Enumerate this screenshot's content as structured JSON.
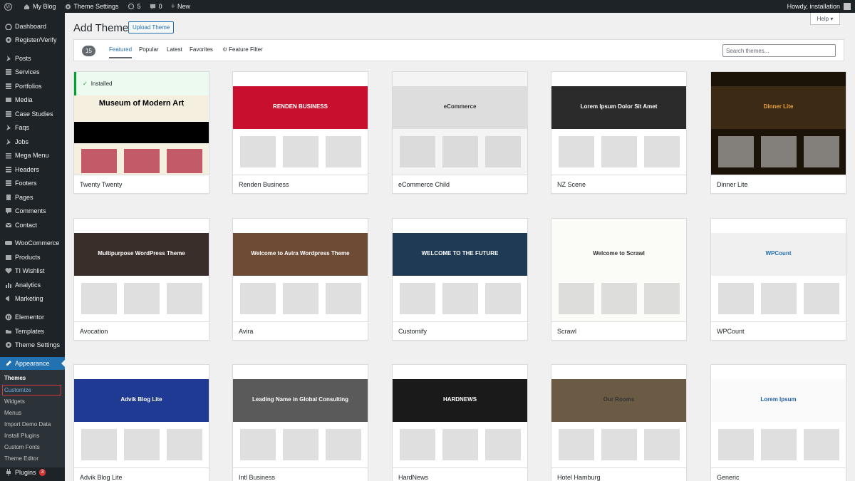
{
  "adminbar": {
    "site": "My Blog",
    "theme_settings": "Theme Settings",
    "updates": "5",
    "comments": "0",
    "new": "New",
    "howdy": "Howdy, installation"
  },
  "sidebar": {
    "items": [
      {
        "label": "Dashboard",
        "icon": "dashboard-icon"
      },
      {
        "label": "Register/Verify",
        "icon": "gear-icon"
      },
      {
        "label": "Posts",
        "icon": "pin-icon"
      },
      {
        "label": "Services",
        "icon": "list-icon"
      },
      {
        "label": "Portfolios",
        "icon": "list-icon"
      },
      {
        "label": "Media",
        "icon": "media-icon"
      },
      {
        "label": "Case Studies",
        "icon": "list-icon"
      },
      {
        "label": "Faqs",
        "icon": "pin-icon"
      },
      {
        "label": "Jobs",
        "icon": "pin-icon"
      },
      {
        "label": "Mega Menu",
        "icon": "menu-icon"
      },
      {
        "label": "Headers",
        "icon": "list-icon"
      },
      {
        "label": "Footers",
        "icon": "list-icon"
      },
      {
        "label": "Pages",
        "icon": "page-icon"
      },
      {
        "label": "Comments",
        "icon": "comment-icon"
      },
      {
        "label": "Contact",
        "icon": "mail-icon"
      },
      {
        "label": "WooCommerce",
        "icon": "woo-icon"
      },
      {
        "label": "Products",
        "icon": "box-icon"
      },
      {
        "label": "TI Wishlist",
        "icon": "heart-icon"
      },
      {
        "label": "Analytics",
        "icon": "chart-icon"
      },
      {
        "label": "Marketing",
        "icon": "megaphone-icon"
      },
      {
        "label": "Elementor",
        "icon": "elementor-icon"
      },
      {
        "label": "Templates",
        "icon": "folder-icon"
      },
      {
        "label": "Theme Settings",
        "icon": "gear-icon"
      },
      {
        "label": "Appearance",
        "icon": "brush-icon"
      }
    ],
    "submenu": [
      "Themes",
      "Customize",
      "Widgets",
      "Menus",
      "Import Demo Data",
      "Install Plugins",
      "Custom Fonts",
      "Theme Editor"
    ],
    "plugins": {
      "label": "Plugins",
      "badge": "3"
    }
  },
  "header": {
    "title": "Add Themes",
    "upload": "Upload Theme",
    "help": "Help ▾"
  },
  "filters": {
    "count": "15",
    "tabs": [
      "Featured",
      "Popular",
      "Latest",
      "Favorites"
    ],
    "feature_filter": "Feature Filter",
    "search_placeholder": "Search themes..."
  },
  "installed_label": "Installed",
  "themes": [
    {
      "name": "Twenty Twenty",
      "text": "Museum of Modern Art"
    },
    {
      "name": "Renden Business",
      "text": "RENDEN BUSINESS"
    },
    {
      "name": "eCommerce Child",
      "text": "eCommerce"
    },
    {
      "name": "NZ Scene",
      "text": "Lorem Ipsum Dolor Sit Amet"
    },
    {
      "name": "Dinner Lite",
      "text": "Dinner Lite"
    },
    {
      "name": "Avocation",
      "text": "Multipurpose WordPress Theme"
    },
    {
      "name": "Avira",
      "text": "Welcome to Avira Wordpress Theme"
    },
    {
      "name": "Customify",
      "text": "WELCOME TO THE FUTURE"
    },
    {
      "name": "Scrawl",
      "text": "Welcome to Scrawl"
    },
    {
      "name": "WPCount",
      "text": "WPCount"
    },
    {
      "name": "Advik Blog Lite",
      "text": "Advik Blog Lite"
    },
    {
      "name": "Intl Business",
      "text": "Leading Name in Global Consulting"
    },
    {
      "name": "HardNews",
      "text": "HARDNEWS"
    },
    {
      "name": "Hotel Hamburg",
      "text": "Our Rooms"
    },
    {
      "name": "Generic",
      "text": "Lorem Ipsum"
    }
  ]
}
